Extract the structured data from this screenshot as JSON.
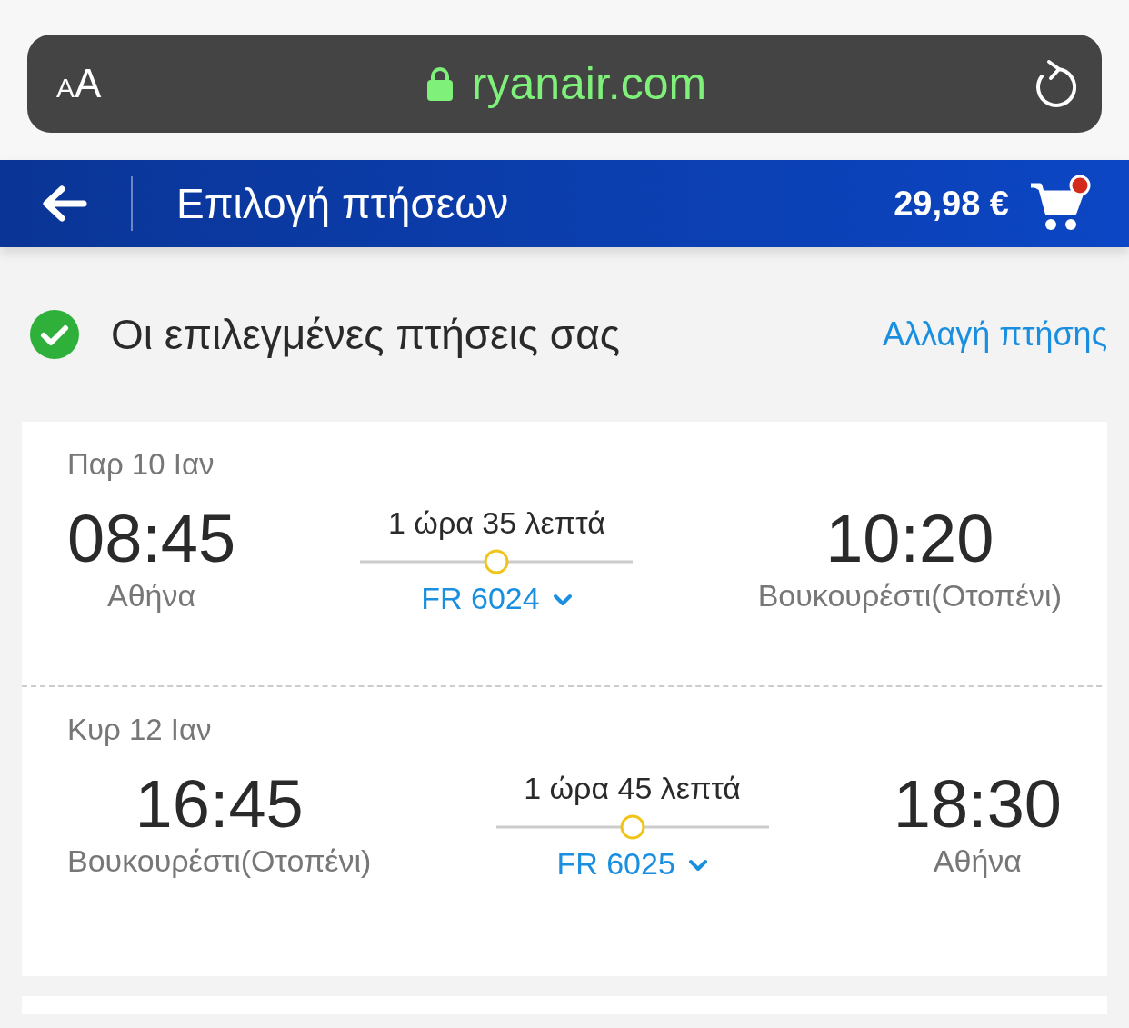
{
  "browser_bar": {
    "text_size_label": "AA",
    "url": "ryanair.com"
  },
  "header": {
    "title": "Επιλογή πτήσεων",
    "price": "29,98 €",
    "cart_has_items": true
  },
  "section": {
    "title": "Οι επιλεγμένες πτήσεις σας",
    "action": "Αλλαγή πτήσης"
  },
  "flights": [
    {
      "date": "Παρ 10 Ιαν",
      "departure_time": "08:45",
      "departure_city": "Αθήνα",
      "duration": "1 ώρα 35 λεπτά",
      "flight_number": "FR 6024",
      "arrival_time": "10:20",
      "arrival_city": "Βουκουρέστι(Οτοπένι)"
    },
    {
      "date": "Κυρ 12 Ιαν",
      "departure_time": "16:45",
      "departure_city": "Βουκουρέστι(Οτοπένι)",
      "duration": "1 ώρα 45 λεπτά",
      "flight_number": "FR 6025",
      "arrival_time": "18:30",
      "arrival_city": "Αθήνα"
    }
  ]
}
